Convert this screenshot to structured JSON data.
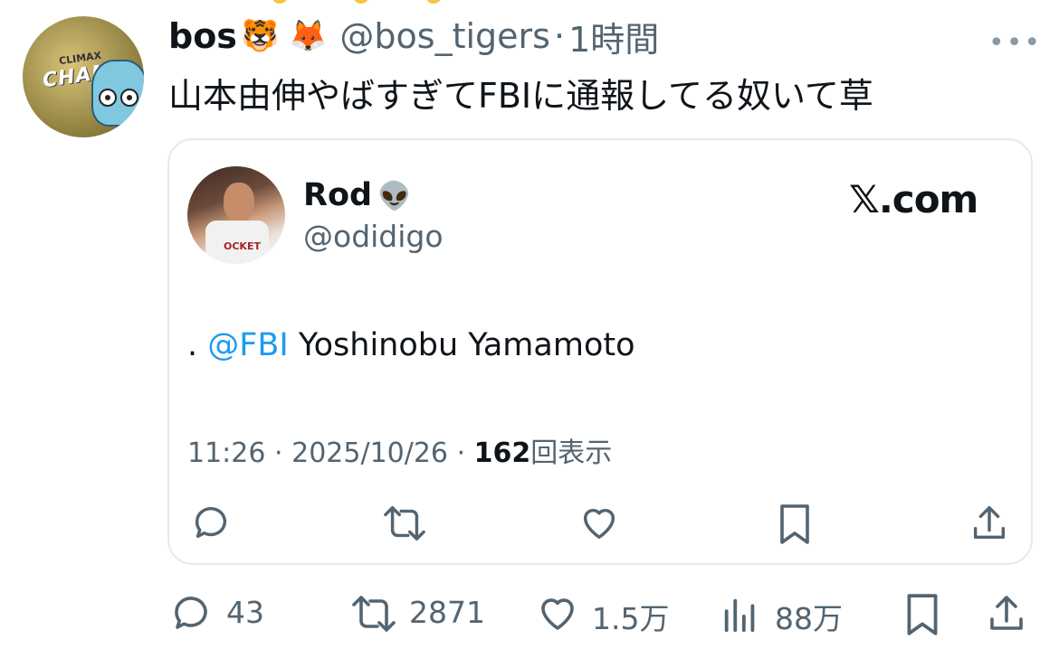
{
  "tweet": {
    "name": "bos",
    "name_emojis": "🐯 🦊",
    "handle": "@bos_tigers",
    "separator": "·",
    "time": "1時間",
    "more": "•••",
    "text": "山本由伸やばすぎてFBIに通報してる奴いて草",
    "avatar_text": "CHAM"
  },
  "quote": {
    "name": "Rod",
    "name_emoji": "👽",
    "handle": "@odidigo",
    "source": "𝕏.com",
    "body_prefix": ".",
    "mention": "@FBI",
    "body_suffix": "Yoshinobu Yamamoto",
    "time": "11:26",
    "date": "2025/10/26",
    "view_count": "162",
    "view_label": "回表示",
    "meta_sep": "·",
    "shirt_text": "OCKET"
  },
  "stats": {
    "replies": "43",
    "retweets": "2871",
    "likes": "1.5万",
    "views": "88万"
  },
  "icons": [
    "reply-icon",
    "retweet-icon",
    "like-icon",
    "bookmark-icon",
    "share-icon",
    "views-icon",
    "more-icon"
  ],
  "colors": {
    "accent": "#1d9bf0",
    "text": "#0f1419",
    "secondary": "#536471",
    "border": "#e6e9ec"
  }
}
